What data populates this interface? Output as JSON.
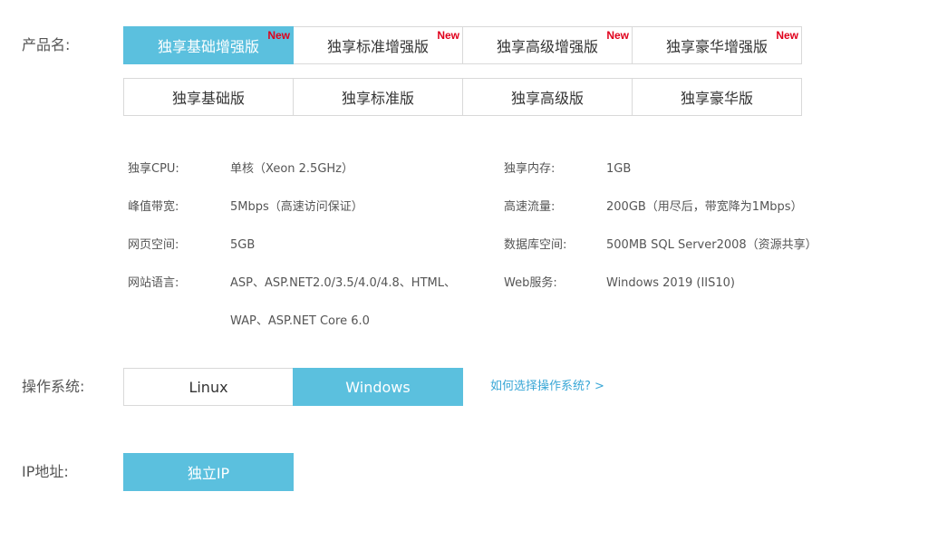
{
  "product": {
    "label": "产品名:",
    "enhanced": [
      {
        "name": "独享基础增强版",
        "badge": "New",
        "selected": true
      },
      {
        "name": "独享标准增强版",
        "badge": "New",
        "selected": false
      },
      {
        "name": "独享高级增强版",
        "badge": "New",
        "selected": false
      },
      {
        "name": "独享豪华增强版",
        "badge": "New",
        "selected": false
      }
    ],
    "basic": [
      {
        "name": "独享基础版"
      },
      {
        "name": "独享标准版"
      },
      {
        "name": "独享高级版"
      },
      {
        "name": "独享豪华版"
      }
    ]
  },
  "specs": {
    "cpu_label": "独享CPU:",
    "cpu_value": "单核（Xeon 2.5GHz）",
    "memory_label": "独享内存:",
    "memory_value": "1GB",
    "bandwidth_label": "峰值带宽:",
    "bandwidth_value": "5Mbps（高速访问保证）",
    "traffic_label": "高速流量:",
    "traffic_value": "200GB（用尽后，带宽降为1Mbps）",
    "space_label": "网页空间:",
    "space_value": "5GB",
    "db_label": "数据库空间:",
    "db_value": "500MB SQL Server2008（资源共享）",
    "lang_label": "网站语言:",
    "lang_value_line1": "ASP、ASP.NET2.0/3.5/4.0/4.8、HTML、",
    "lang_value_line2": "WAP、ASP.NET Core 6.0",
    "web_label": "Web服务:",
    "web_value": "Windows 2019 (IIS10)"
  },
  "os": {
    "label": "操作系统:",
    "options": [
      {
        "name": "Linux",
        "selected": false
      },
      {
        "name": "Windows",
        "selected": true
      }
    ],
    "help_link": "如何选择操作系统? >"
  },
  "ip": {
    "label": "IP地址:",
    "option": "独立IP"
  },
  "colors": {
    "accent": "#5bc0de",
    "badge": "#e0001b",
    "link": "#39a7d6",
    "border": "#d9d9d9"
  }
}
